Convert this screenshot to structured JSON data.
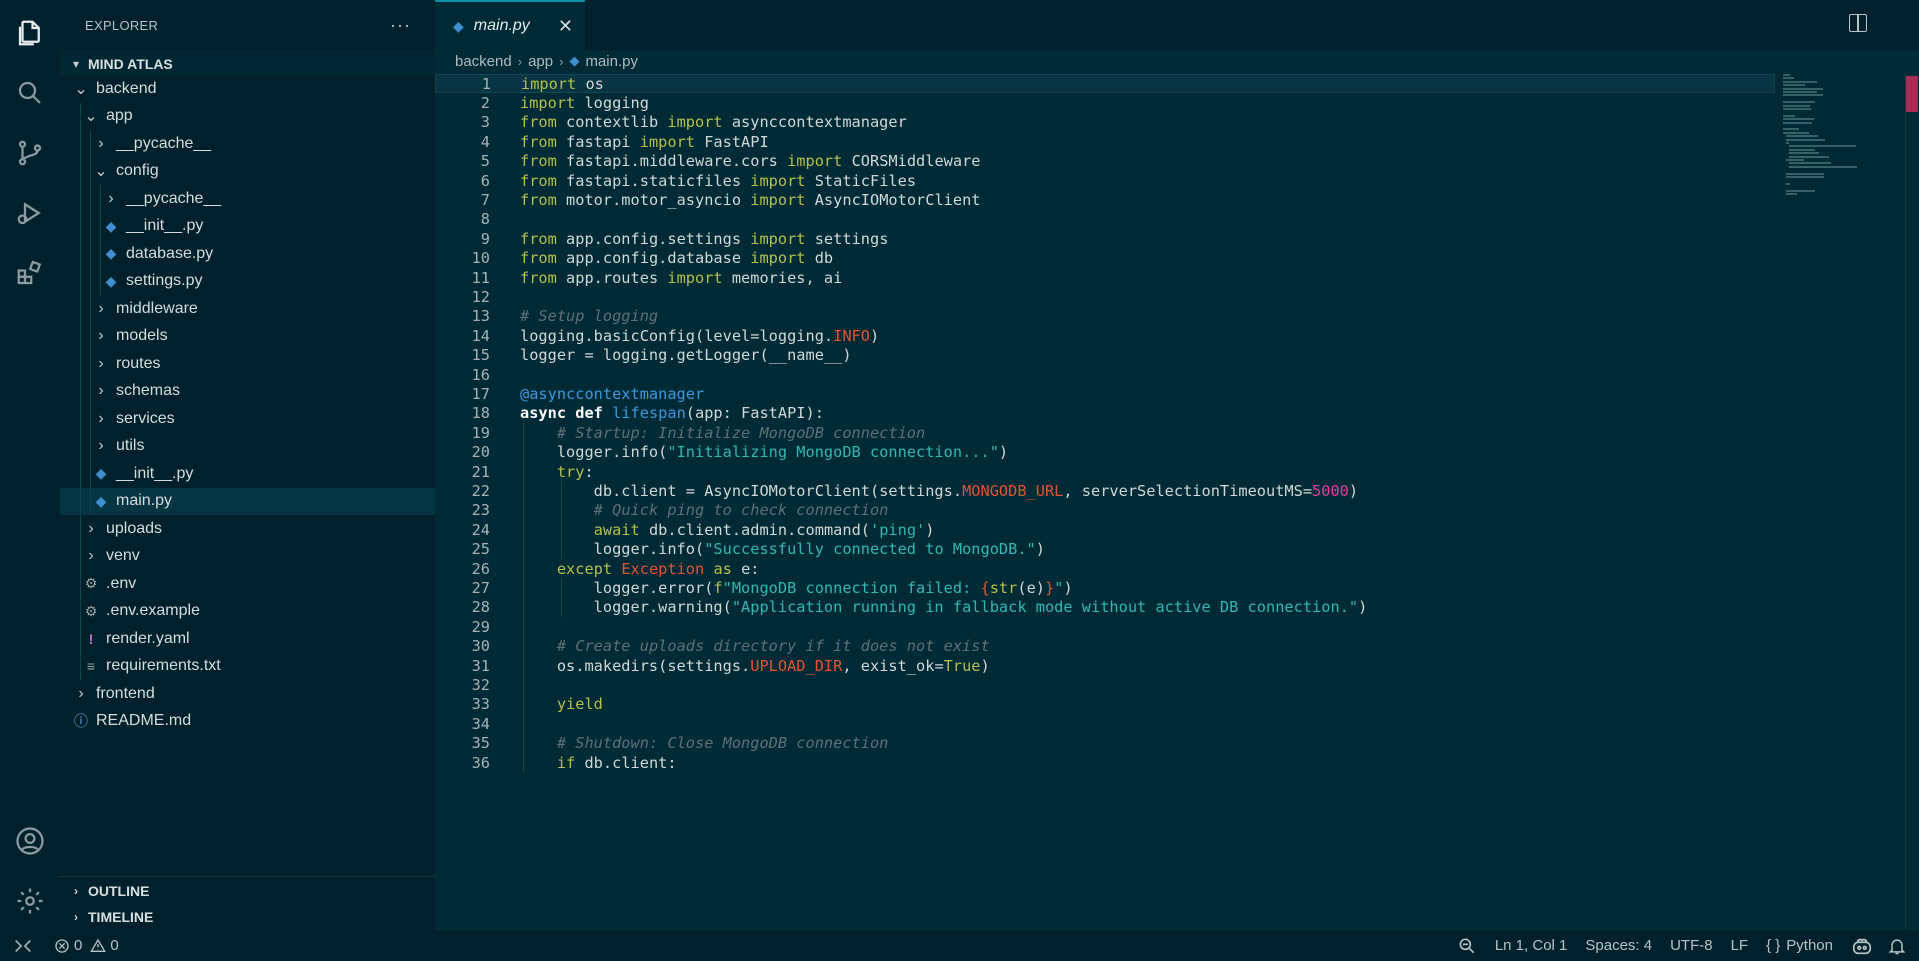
{
  "explorer": {
    "header": "EXPLORER",
    "more": "···",
    "workspace": "MIND ATLAS",
    "tree": [
      {
        "label": "backend",
        "kind": "folder-open",
        "depth": 0
      },
      {
        "label": "app",
        "kind": "folder-open",
        "depth": 1
      },
      {
        "label": "__pycache__",
        "kind": "folder",
        "depth": 2
      },
      {
        "label": "config",
        "kind": "folder-open",
        "depth": 2
      },
      {
        "label": "__pycache__",
        "kind": "folder",
        "depth": 3
      },
      {
        "label": "__init__.py",
        "kind": "py",
        "depth": 3
      },
      {
        "label": "database.py",
        "kind": "py",
        "depth": 3
      },
      {
        "label": "settings.py",
        "kind": "py",
        "depth": 3
      },
      {
        "label": "middleware",
        "kind": "folder",
        "depth": 2
      },
      {
        "label": "models",
        "kind": "folder",
        "depth": 2
      },
      {
        "label": "routes",
        "kind": "folder",
        "depth": 2
      },
      {
        "label": "schemas",
        "kind": "folder",
        "depth": 2
      },
      {
        "label": "services",
        "kind": "folder",
        "depth": 2
      },
      {
        "label": "utils",
        "kind": "folder",
        "depth": 2
      },
      {
        "label": "__init__.py",
        "kind": "py",
        "depth": 2
      },
      {
        "label": "main.py",
        "kind": "py",
        "depth": 2,
        "selected": true
      },
      {
        "label": "uploads",
        "kind": "folder",
        "depth": 1
      },
      {
        "label": "venv",
        "kind": "folder",
        "depth": 1
      },
      {
        "label": ".env",
        "kind": "gear",
        "depth": 1
      },
      {
        "label": ".env.example",
        "kind": "gear",
        "depth": 1
      },
      {
        "label": "render.yaml",
        "kind": "yaml",
        "depth": 1
      },
      {
        "label": "requirements.txt",
        "kind": "txt",
        "depth": 1
      },
      {
        "label": "frontend",
        "kind": "folder",
        "depth": 0
      },
      {
        "label": "README.md",
        "kind": "info",
        "depth": 0
      }
    ],
    "outline": "OUTLINE",
    "timeline": "TIMELINE"
  },
  "tab": {
    "label": "main.py",
    "close": "✕"
  },
  "breadcrumb": [
    "backend",
    "app",
    "main.py"
  ],
  "code": [
    [
      [
        "kw",
        "import"
      ],
      [
        "t",
        " os"
      ]
    ],
    [
      [
        "kw",
        "import"
      ],
      [
        "t",
        " logging"
      ]
    ],
    [
      [
        "kw",
        "from"
      ],
      [
        "t",
        " contextlib "
      ],
      [
        "kw",
        "import"
      ],
      [
        "t",
        " asynccontextmanager"
      ]
    ],
    [
      [
        "kw",
        "from"
      ],
      [
        "t",
        " fastapi "
      ],
      [
        "kw",
        "import"
      ],
      [
        "t",
        " FastAPI"
      ]
    ],
    [
      [
        "kw",
        "from"
      ],
      [
        "t",
        " fastapi.middleware.cors "
      ],
      [
        "kw",
        "import"
      ],
      [
        "t",
        " CORSMiddleware"
      ]
    ],
    [
      [
        "kw",
        "from"
      ],
      [
        "t",
        " fastapi.staticfiles "
      ],
      [
        "kw",
        "import"
      ],
      [
        "t",
        " StaticFiles"
      ]
    ],
    [
      [
        "kw",
        "from"
      ],
      [
        "t",
        " motor.motor_asyncio "
      ],
      [
        "kw",
        "import"
      ],
      [
        "t",
        " AsyncIOMotorClient"
      ]
    ],
    [],
    [
      [
        "kw",
        "from"
      ],
      [
        "t",
        " app.config.settings "
      ],
      [
        "kw",
        "import"
      ],
      [
        "t",
        " settings"
      ]
    ],
    [
      [
        "kw",
        "from"
      ],
      [
        "t",
        " app.config.database "
      ],
      [
        "kw",
        "import"
      ],
      [
        "t",
        " db"
      ]
    ],
    [
      [
        "kw",
        "from"
      ],
      [
        "t",
        " app.routes "
      ],
      [
        "kw",
        "import"
      ],
      [
        "t",
        " memories, ai"
      ]
    ],
    [],
    [
      [
        "cm",
        "# Setup logging"
      ]
    ],
    [
      [
        "t",
        "logging.basicConfig(level="
      ],
      [
        "t",
        "logging."
      ],
      [
        "con",
        "INFO"
      ],
      [
        "t",
        ")"
      ]
    ],
    [
      [
        "t",
        "logger = logging.getLogger(__name__)"
      ]
    ],
    [],
    [
      [
        "fn",
        "@asynccontextmanager"
      ]
    ],
    [
      [
        "kwb",
        "async def "
      ],
      [
        "fn",
        "lifespan"
      ],
      [
        "t",
        "(app: FastAPI):"
      ]
    ],
    [
      [
        "t",
        "    "
      ],
      [
        "cm",
        "# Startup: Initialize MongoDB connection"
      ]
    ],
    [
      [
        "t",
        "    logger.info("
      ],
      [
        "str",
        "\"Initializing MongoDB connection...\""
      ],
      [
        "t",
        ")"
      ]
    ],
    [
      [
        "t",
        "    "
      ],
      [
        "kw",
        "try"
      ],
      [
        "t",
        ":"
      ]
    ],
    [
      [
        "t",
        "        db.client = AsyncIOMotorClient(settings."
      ],
      [
        "con",
        "MONGODB_URL"
      ],
      [
        "t",
        ", serverSelectionTimeoutMS="
      ],
      [
        "num",
        "5000"
      ],
      [
        "t",
        ")"
      ]
    ],
    [
      [
        "t",
        "        "
      ],
      [
        "cm",
        "# Quick ping to check connection"
      ]
    ],
    [
      [
        "t",
        "        "
      ],
      [
        "kw",
        "await"
      ],
      [
        "t",
        " db.client.admin.command("
      ],
      [
        "str",
        "'ping'"
      ],
      [
        "t",
        ")"
      ]
    ],
    [
      [
        "t",
        "        logger.info("
      ],
      [
        "str",
        "\"Successfully connected to MongoDB.\""
      ],
      [
        "t",
        ")"
      ]
    ],
    [
      [
        "t",
        "    "
      ],
      [
        "kw",
        "except"
      ],
      [
        "t",
        " "
      ],
      [
        "cls",
        "Exception"
      ],
      [
        "t",
        " "
      ],
      [
        "kw",
        "as"
      ],
      [
        "t",
        " e:"
      ]
    ],
    [
      [
        "t",
        "        logger.error("
      ],
      [
        "kw",
        "f"
      ],
      [
        "str",
        "\"MongoDB connection failed: "
      ],
      [
        "con",
        "{"
      ],
      [
        "kw",
        "str"
      ],
      [
        "t",
        "(e)"
      ],
      [
        "con",
        "}"
      ],
      [
        "str",
        "\""
      ],
      [
        "t",
        ")"
      ]
    ],
    [
      [
        "t",
        "        logger.warning("
      ],
      [
        "str",
        "\"Application running in fallback mode without active DB connection.\""
      ],
      [
        "t",
        ")"
      ]
    ],
    [],
    [
      [
        "t",
        "    "
      ],
      [
        "cm",
        "# Create uploads directory if it does not exist"
      ]
    ],
    [
      [
        "t",
        "    os.makedirs(settings."
      ],
      [
        "con",
        "UPLOAD_DIR"
      ],
      [
        "t",
        ", exist_ok="
      ],
      [
        "kw",
        "True"
      ],
      [
        "t",
        ")"
      ]
    ],
    [],
    [
      [
        "t",
        "    "
      ],
      [
        "kw",
        "yield"
      ]
    ],
    [],
    [
      [
        "t",
        "    "
      ],
      [
        "cm",
        "# Shutdown: Close MongoDB connection"
      ]
    ],
    [
      [
        "t",
        "    "
      ],
      [
        "kw",
        "if"
      ],
      [
        "t",
        " db.client:"
      ]
    ]
  ],
  "status": {
    "errors": "0",
    "warnings": "0",
    "position": "Ln 1, Col 1",
    "spaces": "Spaces: 4",
    "encoding": "UTF-8",
    "eol": "LF",
    "language": "Python",
    "language_icon": "{ }"
  },
  "colors": {
    "accent": "#0b8fa8",
    "background": "#002b36",
    "sidebar": "#00212b"
  }
}
